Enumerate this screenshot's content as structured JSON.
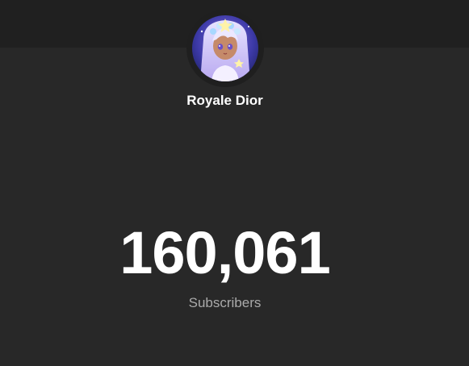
{
  "channel": {
    "name": "Royale Dior",
    "avatar_icon": "anime-character-avatar"
  },
  "stats": {
    "subscriber_count": "160,061",
    "subscriber_label": "Subscribers"
  },
  "colors": {
    "background": "#282828",
    "top_bar": "#202020",
    "count_text": "#ffffff",
    "label_text": "#aaaaaa"
  }
}
